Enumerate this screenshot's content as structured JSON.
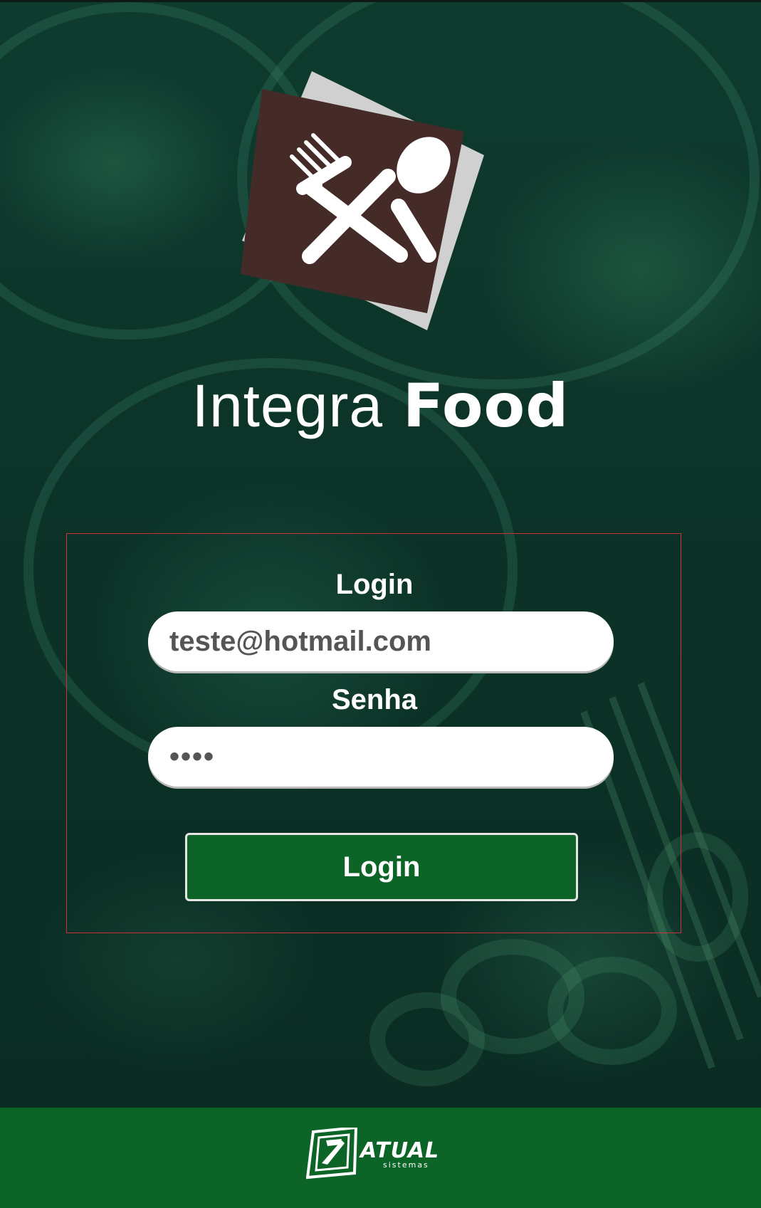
{
  "brand": {
    "name_light": "Integra",
    "name_bold": "Food"
  },
  "logo": {
    "icon": "fork-and-spoon-icon",
    "tile_color": "#452b28",
    "back_tile_color": "#d0d0d0"
  },
  "form": {
    "login_label": "Login",
    "login_value": "teste@hotmail.com",
    "password_label": "Senha",
    "password_value": "••••",
    "submit_label": "Login"
  },
  "footer": {
    "company": "ATUAL",
    "company_sub": "sistemas"
  },
  "colors": {
    "accent_green": "#0c6427",
    "form_border": "#d0323a"
  }
}
